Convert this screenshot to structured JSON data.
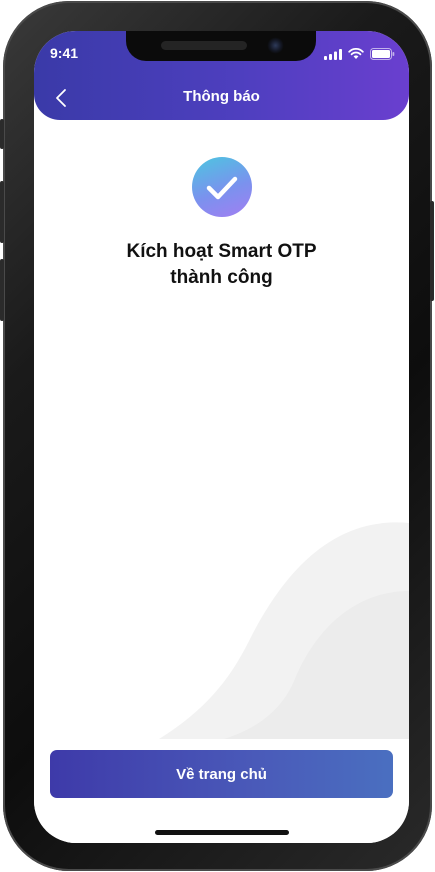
{
  "status_bar": {
    "time": "9:41"
  },
  "header": {
    "title": "Thông báo"
  },
  "result": {
    "line1": "Kích hoạt Smart OTP",
    "line2": "thành công"
  },
  "footer": {
    "home_button_label": "Về trang chủ"
  },
  "colors": {
    "header_start": "#3a3aa8",
    "header_end": "#6a3fcf",
    "button_start": "#3e3aa9",
    "button_end": "#4a6fc0",
    "check_start": "#4cc6e0",
    "check_end": "#a27ef2"
  },
  "icons": [
    "back-arrow-icon",
    "signal-icon",
    "wifi-icon",
    "battery-icon",
    "checkmark-icon"
  ]
}
